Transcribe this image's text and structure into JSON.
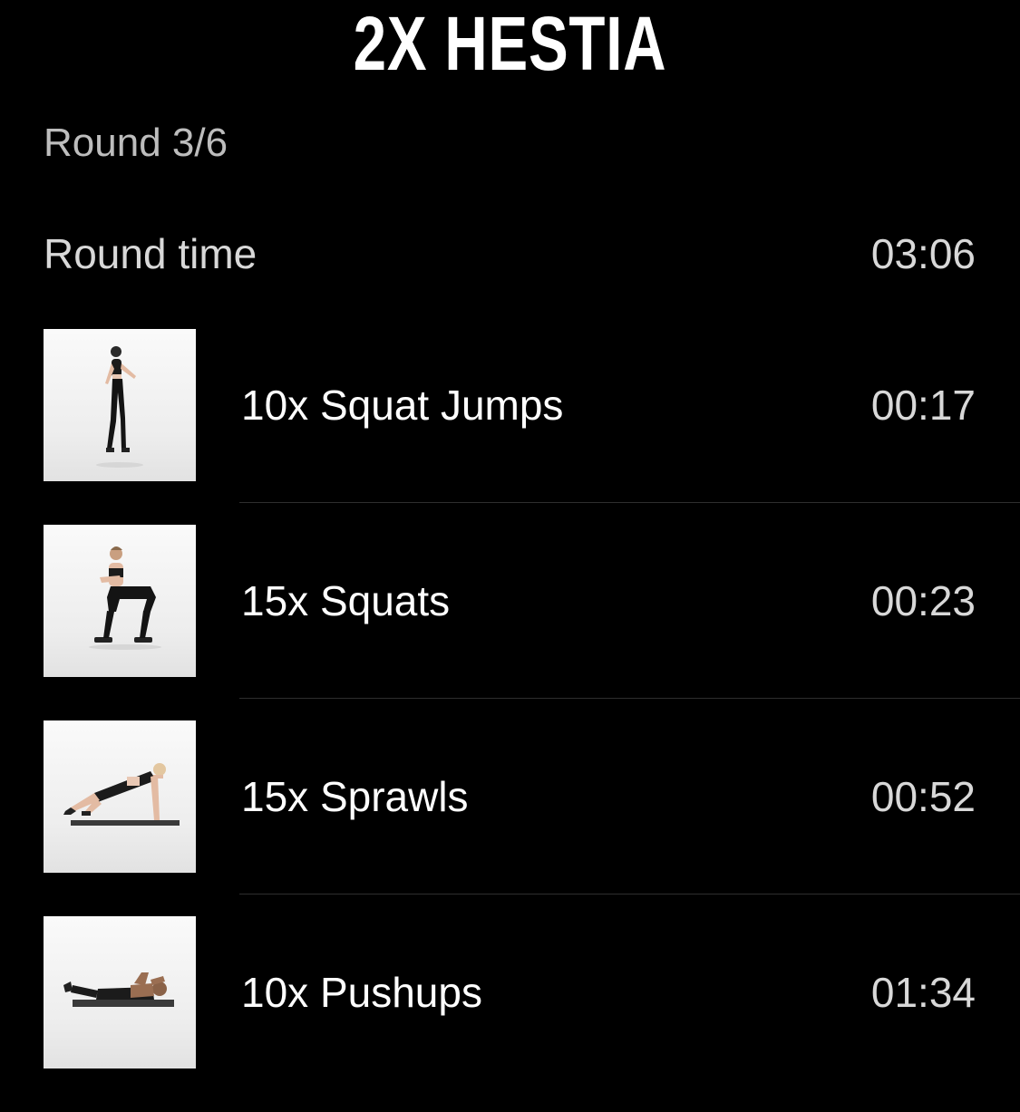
{
  "header": {
    "title": "2X HESTIA"
  },
  "round": {
    "label": "Round 3/6"
  },
  "round_time": {
    "label": "Round time",
    "value": "03:06"
  },
  "exercises": [
    {
      "name": "10x Squat Jumps",
      "time": "00:17",
      "thumbnail": "squat-jump-thumbnail"
    },
    {
      "name": "15x Squats",
      "time": "00:23",
      "thumbnail": "squat-thumbnail"
    },
    {
      "name": "15x Sprawls",
      "time": "00:52",
      "thumbnail": "sprawl-thumbnail"
    },
    {
      "name": "10x Pushups",
      "time": "01:34",
      "thumbnail": "pushup-thumbnail"
    }
  ],
  "colors": {
    "background": "#000000",
    "primary_text": "#ffffff",
    "secondary_text": "#bdbdbd",
    "divider": "#2e2e2e"
  }
}
